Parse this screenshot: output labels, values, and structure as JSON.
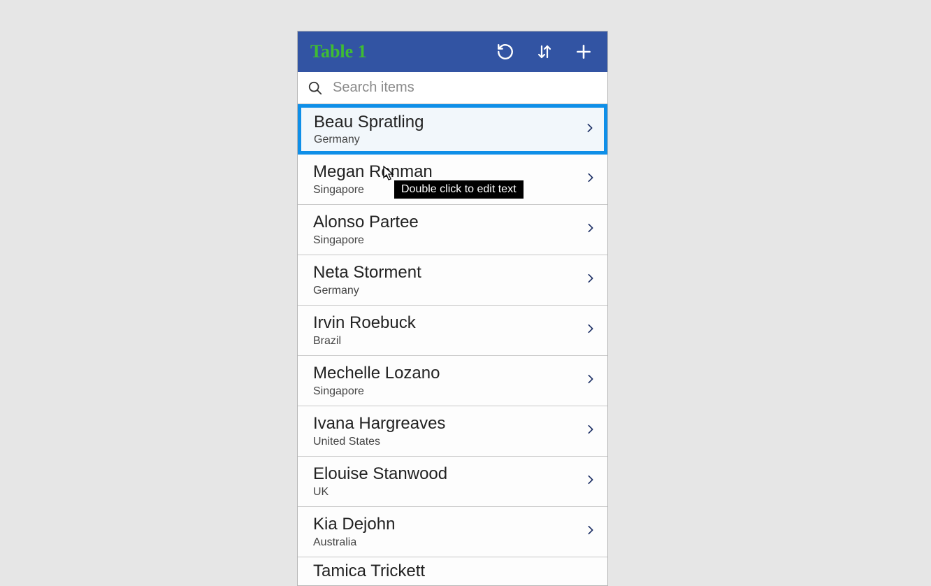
{
  "header": {
    "title": "Table 1"
  },
  "search": {
    "placeholder": "Search items",
    "value": ""
  },
  "tooltip": "Double click to edit text",
  "items": [
    {
      "name": "Beau Spratling",
      "sub": "Germany",
      "selected": true
    },
    {
      "name": "Megan Ronman",
      "sub": "Singapore",
      "selected": false
    },
    {
      "name": "Alonso Partee",
      "sub": "Singapore",
      "selected": false
    },
    {
      "name": "Neta Storment",
      "sub": "Germany",
      "selected": false
    },
    {
      "name": "Irvin Roebuck",
      "sub": "Brazil",
      "selected": false
    },
    {
      "name": "Mechelle Lozano",
      "sub": "Singapore",
      "selected": false
    },
    {
      "name": "Ivana Hargreaves",
      "sub": "United States",
      "selected": false
    },
    {
      "name": "Elouise Stanwood",
      "sub": "UK",
      "selected": false
    },
    {
      "name": "Kia Dejohn",
      "sub": "Australia",
      "selected": false
    },
    {
      "name": "Tamica Trickett",
      "sub": "",
      "selected": false
    }
  ]
}
